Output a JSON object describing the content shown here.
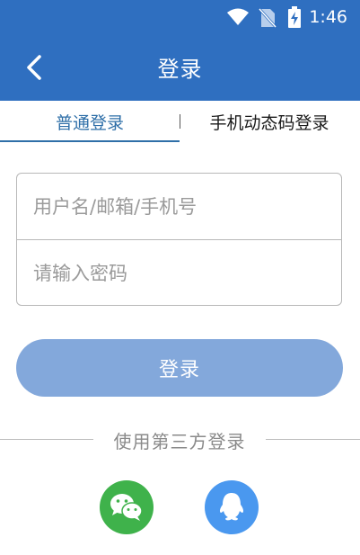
{
  "status_bar": {
    "time": "1:46"
  },
  "header": {
    "title": "登录",
    "back_icon": "chevron-left-icon"
  },
  "tabs": [
    {
      "label": "普通登录",
      "active": true
    },
    {
      "label": "手机动态码登录",
      "active": false
    }
  ],
  "form": {
    "username_placeholder": "用户名/邮箱/手机号",
    "username_value": "",
    "password_placeholder": "请输入密码",
    "password_value": ""
  },
  "login_button_label": "登录",
  "third_party": {
    "label": "使用第三方登录",
    "providers": [
      {
        "icon": "wechat-icon",
        "color": "#3fb24b"
      },
      {
        "icon": "qq-icon",
        "color": "#4a98ef"
      }
    ]
  },
  "colors": {
    "primary": "#2f6fc0",
    "tab_active": "#2f6fa8",
    "button_disabled": "#83a8db"
  }
}
